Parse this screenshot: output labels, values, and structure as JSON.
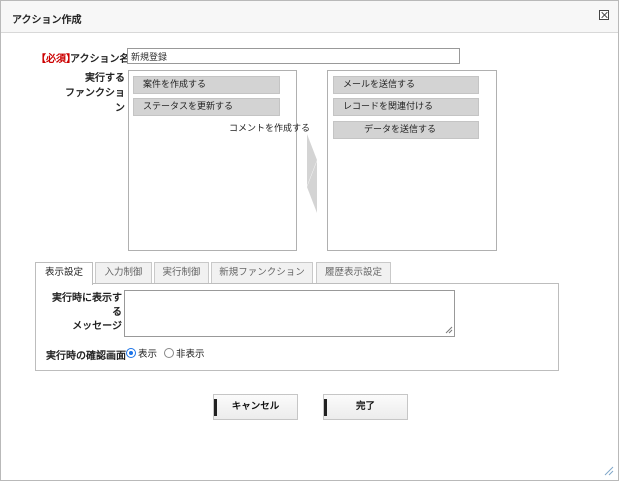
{
  "dialog": {
    "title": "アクション作成",
    "accent_color": "#1a73e8"
  },
  "form": {
    "required_badge": "【必須】",
    "name_label": "アクション名",
    "name_value": "新規登録",
    "functions_label_line1": "実行する",
    "functions_label_line2": "ファンクション"
  },
  "left_list": {
    "items": [
      {
        "label": "案件を作成する"
      },
      {
        "label": "ステータスを更新する"
      }
    ]
  },
  "right_list": {
    "items": [
      {
        "label": "メールを送信する"
      },
      {
        "label": "レコードを関連付ける"
      },
      {
        "label": "データを送信する"
      }
    ]
  },
  "dragging_item": {
    "label": "コメントを作成する"
  },
  "tabs": [
    {
      "label": "表示設定",
      "active": true
    },
    {
      "label": "入力制御",
      "active": false
    },
    {
      "label": "実行制御",
      "active": false
    },
    {
      "label": "新規ファンクション",
      "active": false
    },
    {
      "label": "履歴表示設定",
      "active": false
    }
  ],
  "display_settings": {
    "message_label_line1": "実行時に表示する",
    "message_label_line2": "メッセージ",
    "message_value": "",
    "confirm_label": "実行時の確認画面",
    "options": [
      {
        "label": "表示",
        "selected": true
      },
      {
        "label": "非表示",
        "selected": false
      }
    ]
  },
  "buttons": {
    "cancel": "キャンセル",
    "done": "完了"
  }
}
